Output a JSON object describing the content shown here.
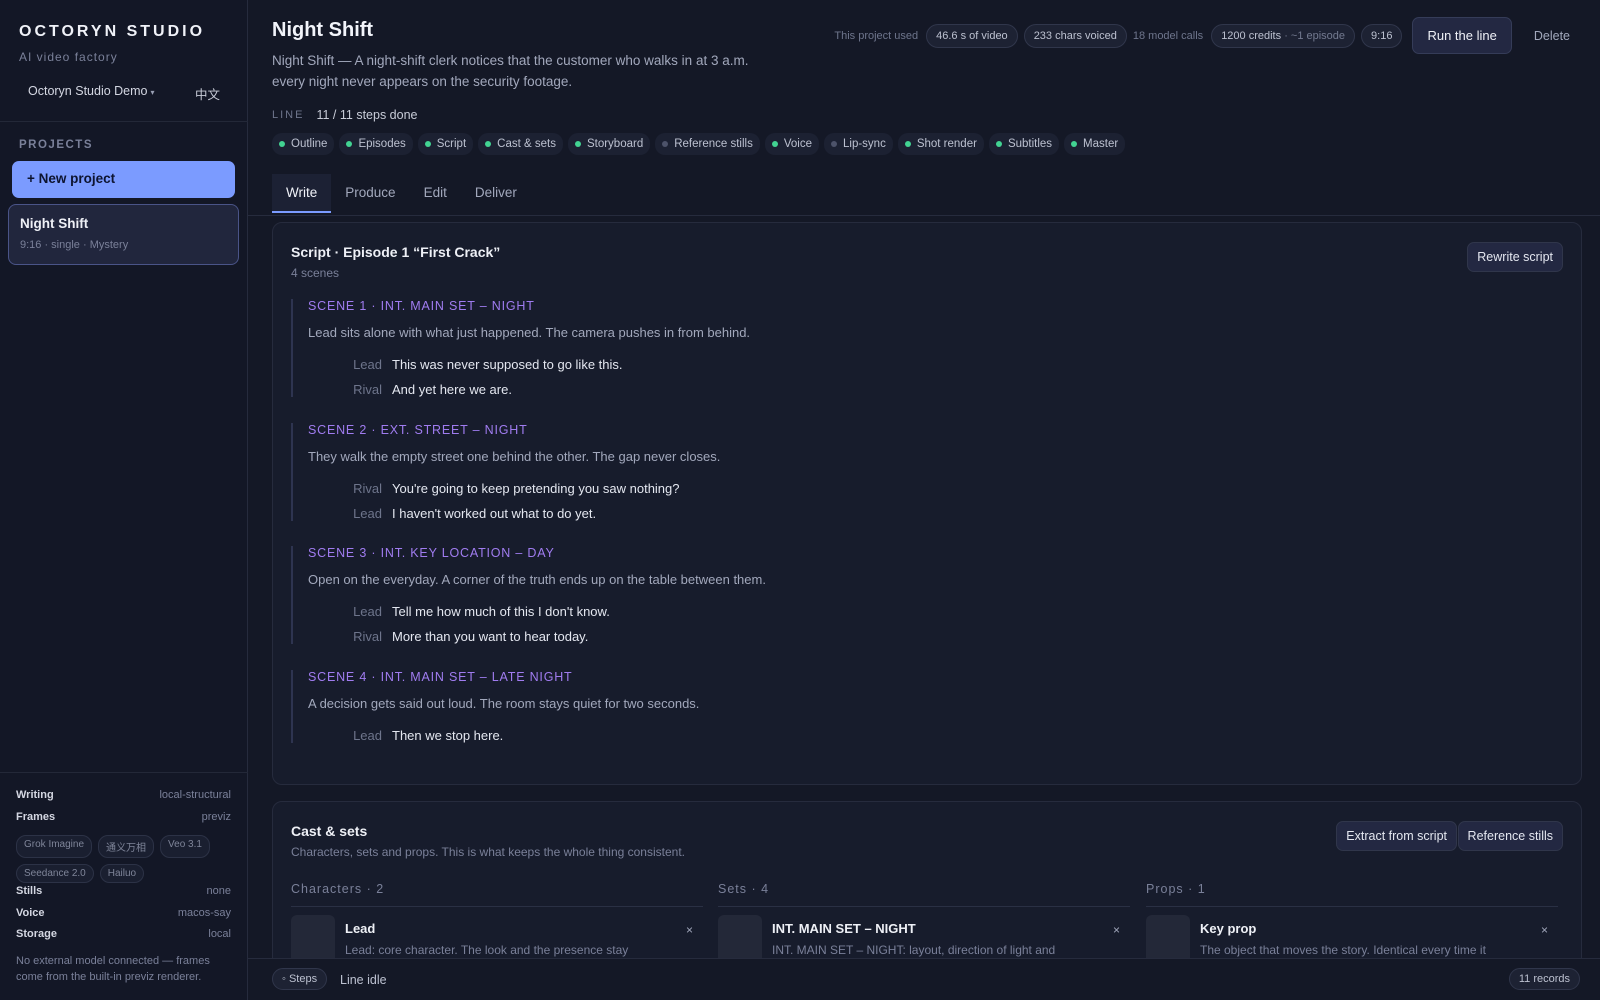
{
  "brand": {
    "name": "OCTORYN STUDIO",
    "tagline": "AI video factory"
  },
  "workspace": {
    "name": "Octoryn Studio Demo",
    "caret": "▾",
    "lang": "中文"
  },
  "sidebar": {
    "projects_header": "PROJECTS",
    "new_project": "+ New project",
    "project": {
      "name": "Night Shift",
      "meta": "9:16 · single · Mystery"
    }
  },
  "config": {
    "writing": {
      "label": "Writing",
      "value": "local-structural"
    },
    "frames": {
      "label": "Frames",
      "value": "previz"
    },
    "frame_chips": [
      "Grok Imagine",
      "通义万相",
      "Veo 3.1",
      "Seedance 2.0",
      "Hailuo"
    ],
    "stills": {
      "label": "Stills",
      "value": "none"
    },
    "voice": {
      "label": "Voice",
      "value": "macos-say"
    },
    "storage": {
      "label": "Storage",
      "value": "local"
    },
    "note": "No external model connected — frames come from the built-in previz renderer."
  },
  "project": {
    "title": "Night Shift",
    "description": "Night Shift — A night-shift clerk notices that the customer who walks in at 3 a.m. every night never appears on the security footage."
  },
  "stats": {
    "label": "This project used",
    "video": "46.6 s of video",
    "chars": "233 chars voiced",
    "calls": "18 model calls",
    "credits": "1200 credits",
    "credits_note": "· ~1 episode",
    "ratio": "9:16",
    "run": "Run the line",
    "delete": "Delete"
  },
  "line": {
    "label": "LINE",
    "progress": "11 / 11 steps done",
    "steps": [
      {
        "label": "Outline",
        "done": true
      },
      {
        "label": "Episodes",
        "done": true
      },
      {
        "label": "Script",
        "done": true
      },
      {
        "label": "Cast & sets",
        "done": true
      },
      {
        "label": "Storyboard",
        "done": true
      },
      {
        "label": "Reference stills",
        "done": false
      },
      {
        "label": "Voice",
        "done": true
      },
      {
        "label": "Lip-sync",
        "done": false
      },
      {
        "label": "Shot render",
        "done": true
      },
      {
        "label": "Subtitles",
        "done": true
      },
      {
        "label": "Master",
        "done": true
      }
    ]
  },
  "tabs": [
    "Write",
    "Produce",
    "Edit",
    "Deliver"
  ],
  "script": {
    "title": "Script · Episode 1 “First Crack”",
    "subtitle": "4 scenes",
    "rewrite": "Rewrite script",
    "scenes": [
      {
        "heading": "SCENE 1 · INT. MAIN SET – NIGHT",
        "description": "Lead sits alone with what just happened. The camera pushes in from behind.",
        "lines": [
          {
            "speaker": "Lead",
            "text": "This was never supposed to go like this."
          },
          {
            "speaker": "Rival",
            "text": "And yet here we are."
          }
        ]
      },
      {
        "heading": "SCENE 2 · EXT. STREET – NIGHT",
        "description": "They walk the empty street one behind the other. The gap never closes.",
        "lines": [
          {
            "speaker": "Rival",
            "text": "You're going to keep pretending you saw nothing?"
          },
          {
            "speaker": "Lead",
            "text": "I haven't worked out what to do yet."
          }
        ]
      },
      {
        "heading": "SCENE 3 · INT. KEY LOCATION – DAY",
        "description": "Open on the everyday. A corner of the truth ends up on the table between them.",
        "lines": [
          {
            "speaker": "Lead",
            "text": "Tell me how much of this I don't know."
          },
          {
            "speaker": "Rival",
            "text": "More than you want to hear today."
          }
        ]
      },
      {
        "heading": "SCENE 4 · INT. MAIN SET – LATE NIGHT",
        "description": "A decision gets said out loud. The room stays quiet for two seconds.",
        "lines": [
          {
            "speaker": "Lead",
            "text": "Then we stop here."
          }
        ]
      }
    ]
  },
  "cast": {
    "title": "Cast & sets",
    "subtitle": "Characters, sets and props. This is what keeps the whole thing consistent.",
    "extract": "Extract from script",
    "refstills": "Reference stills",
    "columns": [
      {
        "header": "Characters · 2",
        "name": "Lead",
        "desc": "Lead: core character. The look and the presence stay"
      },
      {
        "header": "Sets · 4",
        "name": "INT. MAIN SET – NIGHT",
        "desc": "INT. MAIN SET – NIGHT: layout, direction of light and"
      },
      {
        "header": "Props · 1",
        "name": "Key prop",
        "desc": "The object that moves the story. Identical every time it"
      }
    ],
    "remove": "×"
  },
  "status": {
    "steps": "◦ Steps",
    "idle": "Line idle",
    "records": "11 records"
  }
}
